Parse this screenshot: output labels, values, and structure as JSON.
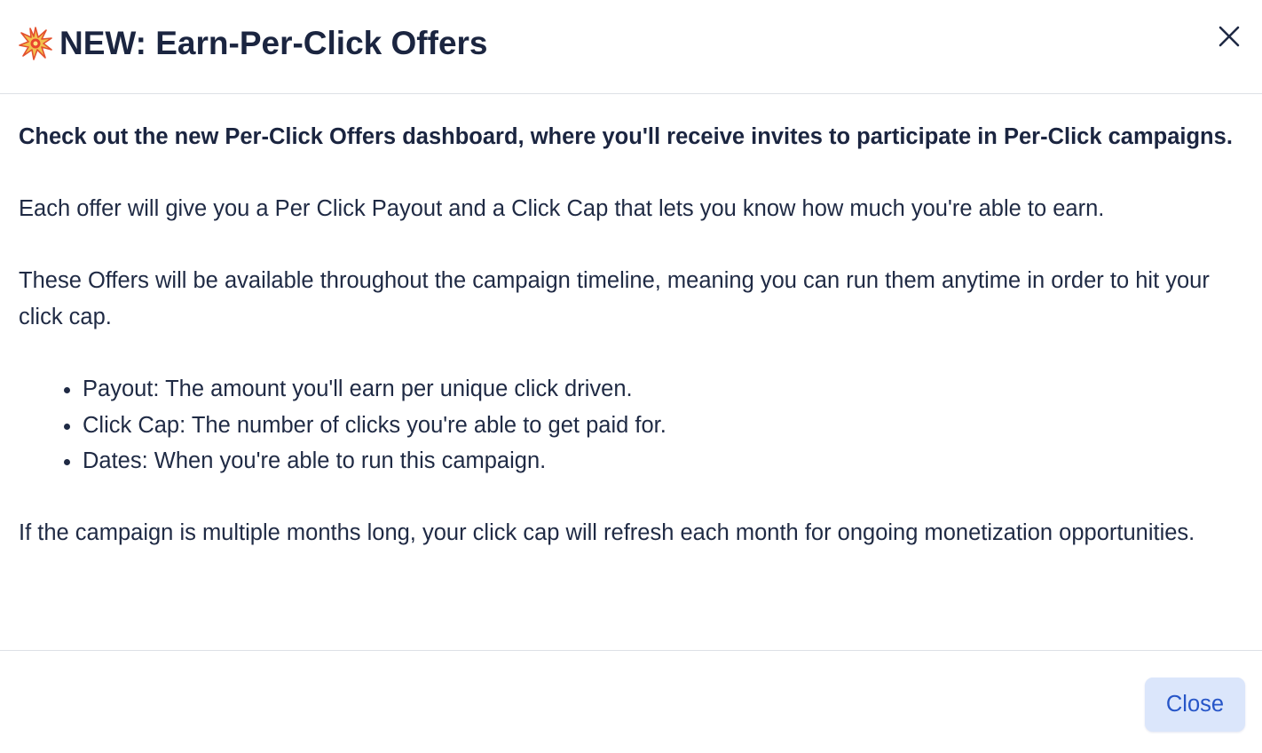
{
  "modal": {
    "title_icon": "collision-emoji-icon",
    "title": "NEW: Earn-Per-Click Offers",
    "close_icon": "close-icon",
    "intro": "Check out the new Per-Click Offers dashboard, where you'll receive invites to participate in Per-Click campaigns.",
    "paragraph_1": "Each offer will give you a Per Click Payout and a Click Cap that lets you know how much you're able to earn.",
    "paragraph_2": "These Offers will be available throughout the campaign timeline, meaning you can run them anytime in order to hit your click cap.",
    "bullets": [
      "Payout: The amount you'll earn per unique click driven.",
      "Click Cap: The number of clicks you're able to get paid for.",
      "Dates: When you're able to run this campaign."
    ],
    "paragraph_3": "If the campaign is multiple months long, your click cap will refresh each month for ongoing monetization opportunities.",
    "close_label": "Close"
  },
  "colors": {
    "title_text": "#1b2540",
    "body_text": "#1f2a44",
    "divider": "#dde1e6",
    "button_bg": "#dbe6fb",
    "button_text": "#2756c8"
  }
}
